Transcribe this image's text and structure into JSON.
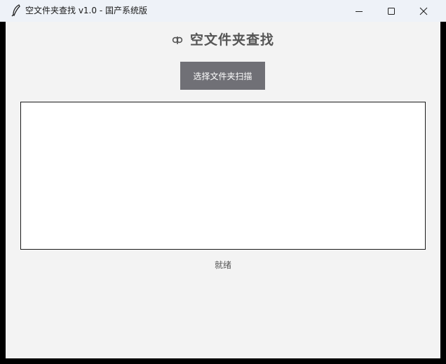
{
  "window": {
    "title": "空文件夹查找  v1.0  -  国产系统版",
    "app_icon": "feather-icon",
    "controls": [
      "minimize-icon",
      "maximize-icon",
      "close-icon"
    ]
  },
  "header": {
    "icon": "magnifier-icon",
    "title": "空文件夹查找"
  },
  "toolbar": {
    "scan_label": "选择文件夹扫描"
  },
  "results": {
    "items": []
  },
  "status": {
    "text": "就绪"
  },
  "colors": {
    "titlebar_bg": "#eef2f8",
    "client_bg": "#f3f3f3",
    "button_bg": "#707076",
    "button_text": "#ffffff",
    "title_text": "#555555"
  }
}
